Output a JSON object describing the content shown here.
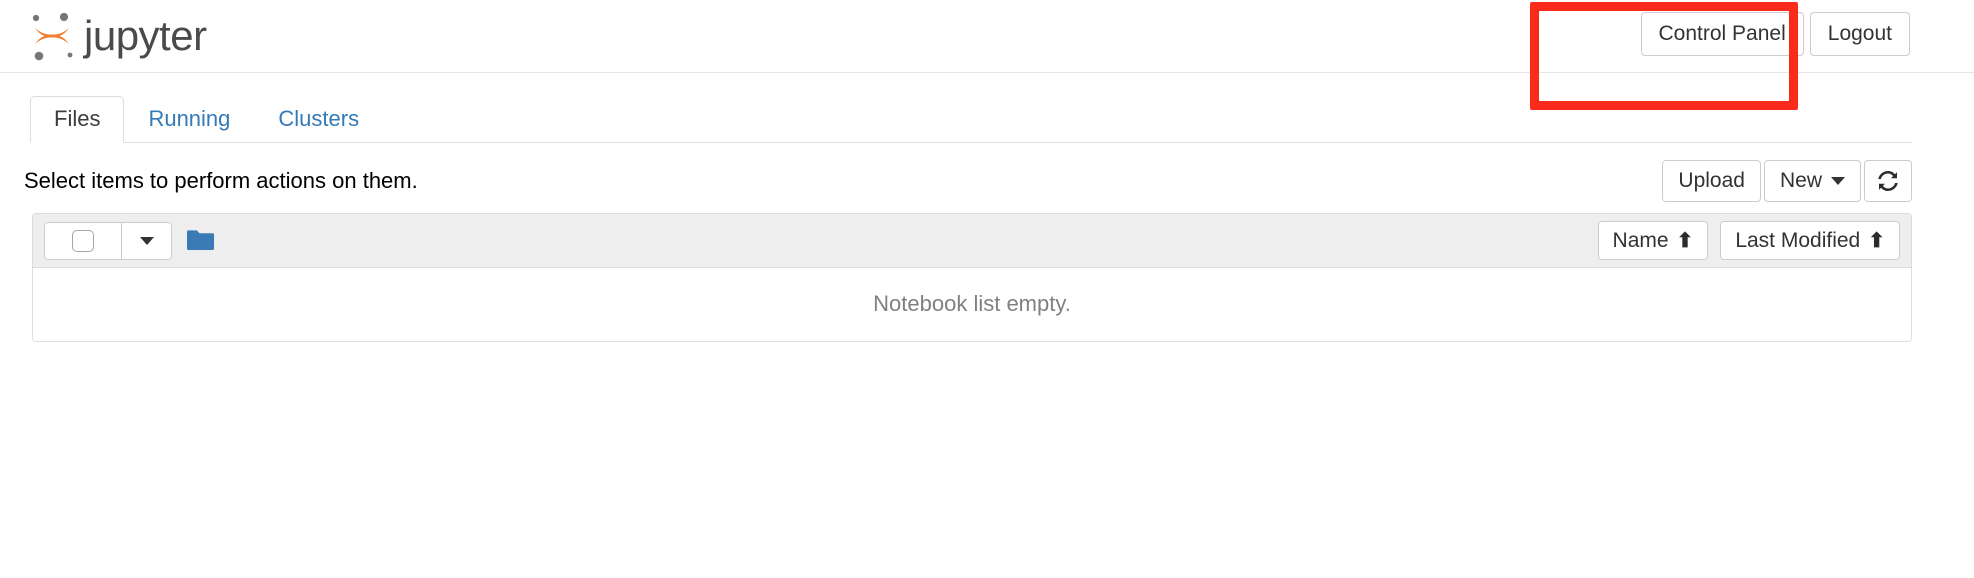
{
  "header": {
    "brand_text": "jupyter",
    "logo_icon": "jupyter-logo-icon",
    "buttons": [
      {
        "label": "Control Panel",
        "name": "control-panel-button"
      },
      {
        "label": "Logout",
        "name": "logout-button"
      }
    ]
  },
  "annotation": {
    "highlight_color": "#fa2b1b",
    "target": "Control Panel"
  },
  "tabs": [
    {
      "label": "Files",
      "active": true
    },
    {
      "label": "Running",
      "active": false
    },
    {
      "label": "Clusters",
      "active": false
    }
  ],
  "actions": {
    "select_hint": "Select items to perform actions on them.",
    "upload_label": "Upload",
    "new_label": "New",
    "new_caret_icon": "chevron-down-icon",
    "refresh_icon": "refresh-icon"
  },
  "list_toolbar": {
    "select_all_checkbox_icon": "checkbox-icon",
    "select_dropdown_icon": "caret-down-icon",
    "folder_icon": "folder-icon",
    "sort_name_label": "Name",
    "sort_name_arrow": "⬆",
    "sort_modified_label": "Last Modified",
    "sort_modified_arrow": "⬆"
  },
  "list_body": {
    "empty_message": "Notebook list empty."
  },
  "colors": {
    "brand_orange": "#ef8134",
    "tab_link_blue": "#337ab7",
    "folder_blue": "#3a7ab5",
    "panel_border": "#dddddd",
    "toolbar_bg": "#eeeeee",
    "muted_text": "#808080"
  }
}
